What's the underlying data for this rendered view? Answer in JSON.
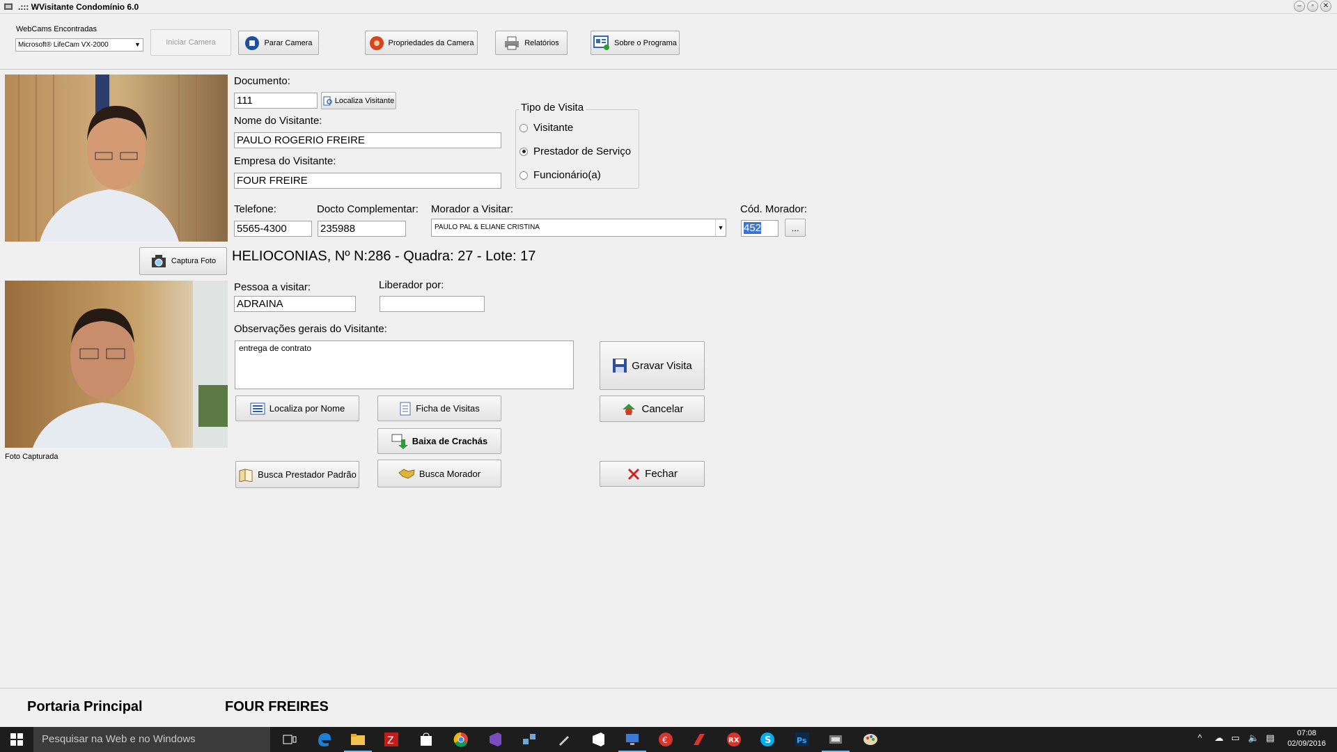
{
  "window": {
    "title": ".:::  WVisitante Condomínio 6.0",
    "controls": [
      "minimize",
      "restore",
      "close"
    ]
  },
  "toolbar": {
    "webcams_label": "WebCams Encontradas",
    "webcam_selected": "Microsoft® LifeCam VX-2000",
    "start_camera": "Iniciar Camera",
    "stop_camera": "Parar Camera",
    "camera_properties": "Propriedades da Camera",
    "reports": "Relatórios",
    "about": "Sobre o Programa"
  },
  "camera": {
    "capture_button": "Captura Foto",
    "captured_label": "Foto Capturada"
  },
  "form": {
    "documento_label": "Documento:",
    "documento_value": "111",
    "localiza_visitante": "Localiza Visitante",
    "nome_label": "Nome do Visitante:",
    "nome_value": "PAULO ROGERIO FREIRE",
    "empresa_label": "Empresa do Visitante:",
    "empresa_value": "FOUR FREIRE",
    "tipo_visita": {
      "title": "Tipo de Visita",
      "options": [
        "Visitante",
        "Prestador de Serviço",
        "Funcionário(a)"
      ],
      "selected": "Prestador de Serviço"
    },
    "telefone_label": "Telefone:",
    "telefone_value": "5565-4300",
    "docto_label": "Docto Complementar:",
    "docto_value": "235988",
    "morador_label": "Morador a Visitar:",
    "morador_value": "PAULO PAL  &  ELIANE CRISTINA",
    "cod_morador_label": "Cód. Morador:",
    "cod_morador_value": "452",
    "ellipsis": "...",
    "address": "HELIOCONIAS, Nº N:286 - Quadra: 27 - Lote: 17",
    "pessoa_label": "Pessoa a visitar:",
    "pessoa_value": "ADRAINA",
    "liberado_label": "Liberador por:",
    "liberado_value": "",
    "observacoes_label": "Observações gerais do Visitante:",
    "observacoes_value": "entrega de contrato"
  },
  "actions": {
    "localiza_nome": "Localiza por Nome",
    "ficha_visitas": "Ficha de Visitas",
    "baixa_crachas": "Baixa de Crachás",
    "busca_prestador": "Busca Prestador Padrão",
    "busca_morador": "Busca Morador",
    "gravar": "Gravar Visita",
    "cancelar": "Cancelar",
    "fechar": "Fechar"
  },
  "status": {
    "portaria": "Portaria Principal",
    "empresa": "FOUR FREIRES"
  },
  "taskbar": {
    "search_placeholder": "Pesquisar na Web e no Windows",
    "apps": [
      "task-view",
      "edge",
      "file-explorer",
      "filezilla",
      "store",
      "chrome",
      "visual-studio",
      "network-tool",
      "pen-tool",
      "visual-studio-2",
      "remote-desktop",
      "app-red",
      "app-red-2",
      "rx",
      "skype",
      "photoshop",
      "wvisitante",
      "paint"
    ],
    "time": "07:08",
    "date": "02/09/2016"
  }
}
